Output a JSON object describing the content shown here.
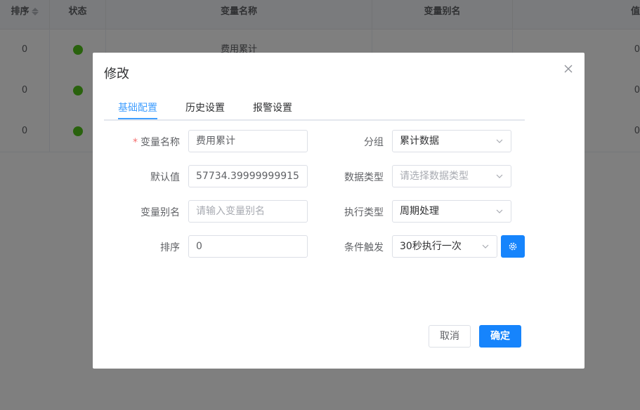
{
  "table": {
    "headers": [
      "排序",
      "状态",
      "变量名称",
      "变量别名",
      "值"
    ],
    "rows": [
      {
        "sort": "0",
        "status_color": "#52c41a",
        "name": "费用累计"
      },
      {
        "sort": "0",
        "status_color": "#52c41a",
        "name": ""
      },
      {
        "sort": "0",
        "status_color": "#52c41a",
        "name": ""
      }
    ],
    "value_col_text": [
      "0",
      "0",
      "0"
    ]
  },
  "dialog": {
    "title": "修改",
    "tabs": [
      "基础配置",
      "历史设置",
      "报警设置"
    ],
    "active_tab": 0,
    "fields": {
      "var_name_label": "变量名称",
      "var_name_value": "费用累计",
      "default_label": "默认值",
      "default_value": "57734.39999999915",
      "alias_label": "变量别名",
      "alias_placeholder": "请输入变量别名",
      "sort_label": "排序",
      "sort_value": "0",
      "group_label": "分组",
      "group_value": "累计数据",
      "datatype_label": "数据类型",
      "datatype_placeholder": "请选择数据类型",
      "exectype_label": "执行类型",
      "exectype_value": "周期处理",
      "trigger_label": "条件触发",
      "trigger_value": "30秒执行一次"
    },
    "buttons": {
      "cancel": "取消",
      "ok": "确定"
    },
    "colors": {
      "accent": "#409eff",
      "primary_button": "#1684fc",
      "required": "#f56c6c"
    }
  }
}
